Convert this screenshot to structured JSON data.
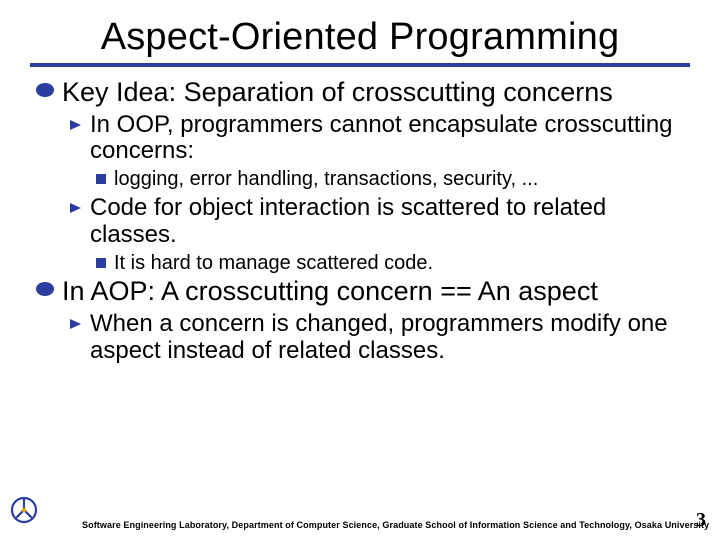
{
  "title": "Aspect-Oriented Programming",
  "bullets": {
    "l1_0": "Key Idea: Separation of crosscutting concerns",
    "l2_0": "In OOP, programmers cannot encapsulate crosscutting concerns:",
    "l3_0": "logging, error handling, transactions, security, ...",
    "l2_1": "Code for object interaction is scattered to related classes.",
    "l3_1": "It is hard to manage scattered code.",
    "l1_1": "In AOP: A crosscutting concern == An aspect",
    "l2_2": "When a concern is changed, programmers modify one aspect instead of related classes."
  },
  "footer": {
    "text": "Software Engineering Laboratory, Department of Computer Science, Graduate School of Information Science and Technology, Osaka University",
    "page": "3"
  },
  "colors": {
    "accent": "#2b3d9e"
  }
}
